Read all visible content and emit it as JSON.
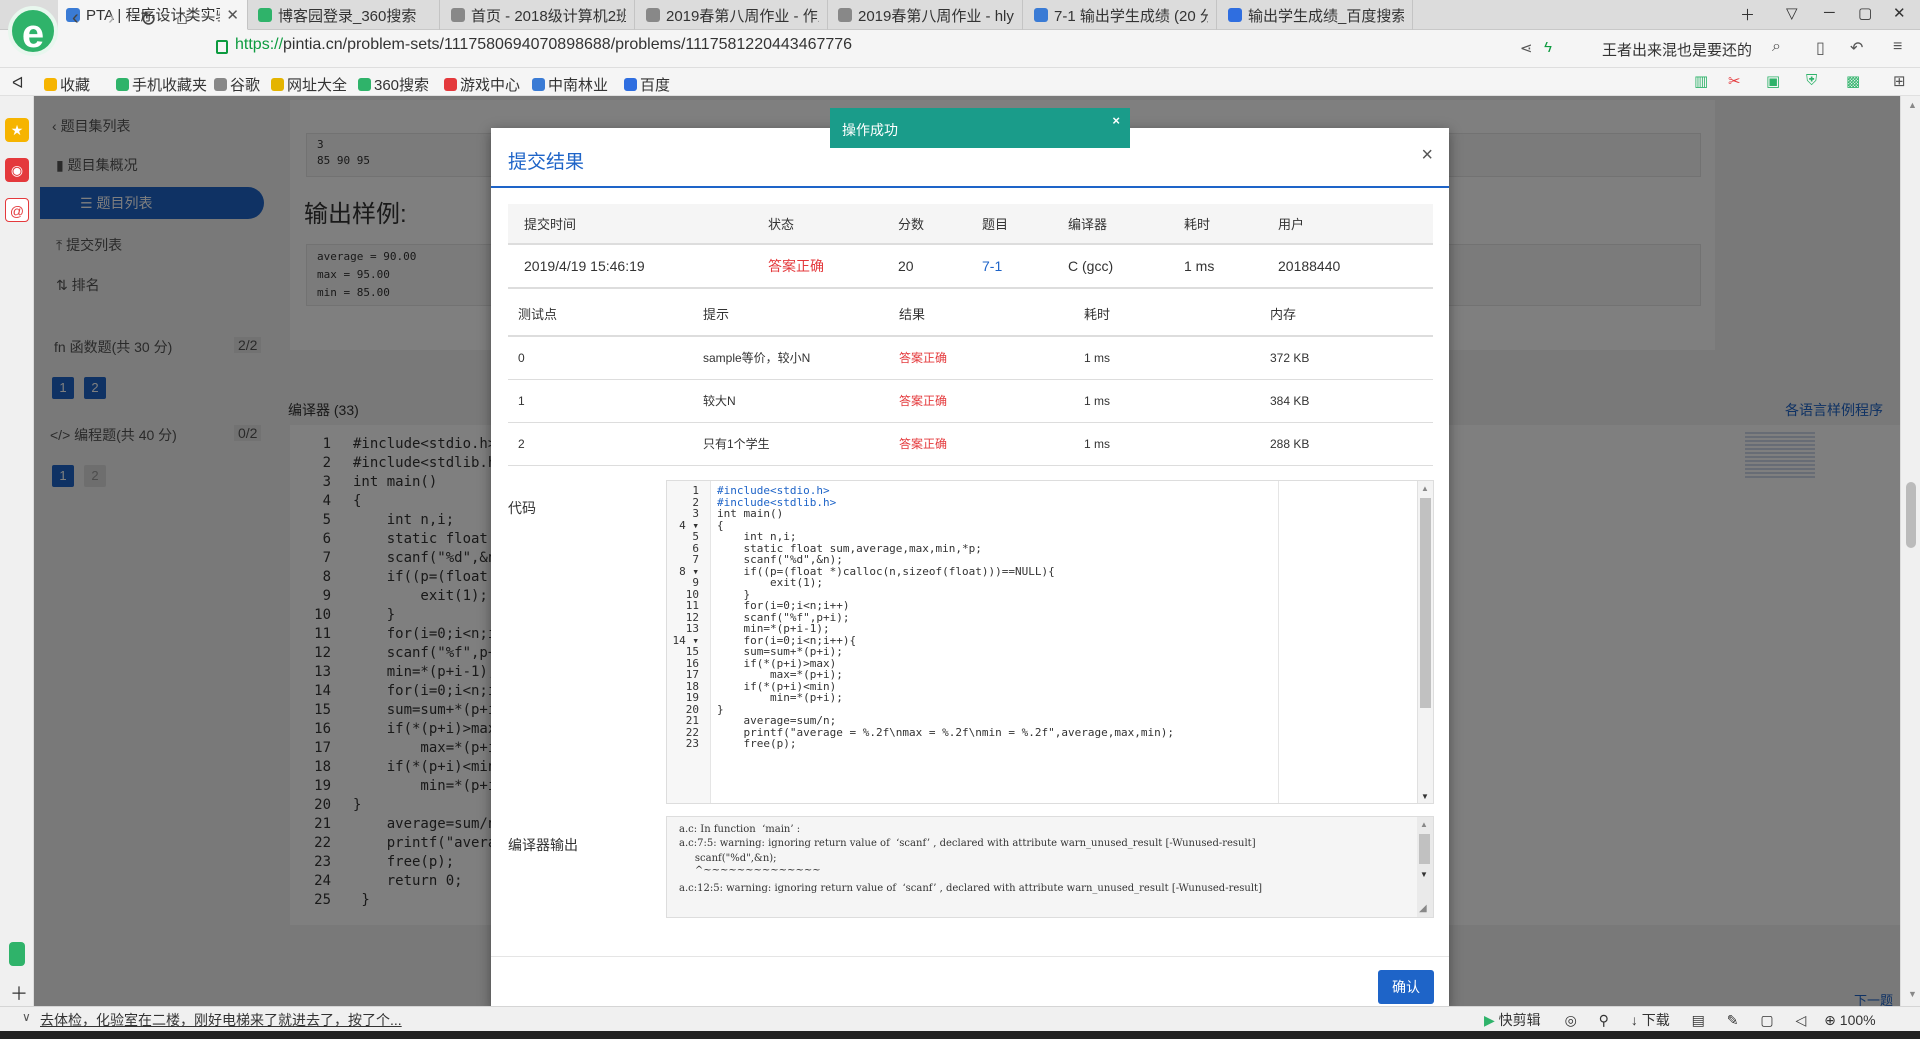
{
  "browser": {
    "tabs": [
      {
        "title": "PTA | 程序设计类实验辅助",
        "color": "#3a7bd5",
        "active": true
      },
      {
        "title": "博客园登录_360搜索",
        "color": "#2fb36a",
        "active": false
      },
      {
        "title": "首页 - 2018级计算机2班 -",
        "color": "#888888",
        "active": false
      },
      {
        "title": "2019春第八周作业 - 作业",
        "color": "#888888",
        "active": false
      },
      {
        "title": "2019春第八周作业 - hlyw",
        "color": "#888888",
        "active": false
      },
      {
        "title": "7-1 输出学生成绩 (20 分)",
        "color": "#3a7bd5",
        "active": false
      },
      {
        "title": "输出学生成绩_百度搜索",
        "color": "#2f6ee0",
        "active": false
      }
    ],
    "url_scheme": "https://",
    "url_rest": "pintia.cn/problem-sets/1117580694070898688/problems/1117581220443467776",
    "search_hint": "王者出来混也是要还的",
    "bookmarks": [
      "收藏",
      "手机收藏夹",
      "谷歌",
      "网址大全",
      "360搜索",
      "游戏中心",
      "中南林业",
      "百度"
    ]
  },
  "sidebar": {
    "back": "题目集列表",
    "items": [
      "题目集概况",
      "题目列表",
      "提交列表",
      "排名"
    ],
    "func_section": "函数题(共 30 分)",
    "func_count": "2/2",
    "prog_section": "编程题(共 40 分)",
    "prog_count": "0/2",
    "pages": [
      "1",
      "2"
    ]
  },
  "problem": {
    "sample_input_lines": [
      "3",
      "85 90 95"
    ],
    "output_title": "输出样例:",
    "sample_output_lines": [
      "average = 90.00",
      "max = 95.00",
      "min = 85.00"
    ],
    "editor_label": "编译器 (33)",
    "other_lang_link": "各语言样例程序",
    "next_link": "下一题"
  },
  "bg_code": [
    "#include<stdio.h>",
    "#include<stdlib.h",
    "int main()",
    "{",
    "    int n,i;",
    "    static float",
    "    scanf(\"%d\",&n",
    "    if((p=(float",
    "        exit(1);",
    "    }",
    "    for(i=0;i<n;i",
    "    scanf(\"%f\",p+",
    "    min=*(p+i-1);",
    "    for(i=0;i<n;i",
    "    sum=sum+*(p+i",
    "    if(*(p+i)>max",
    "        max=*(p+i",
    "    if(*(p+i)<min",
    "        min=*(p+i",
    "}",
    "    average=sum/n",
    "    printf(\"avera",
    "    free(p);",
    "    return 0;",
    " }"
  ],
  "toast": {
    "message": "操作成功",
    "close": "×"
  },
  "modal": {
    "title": "提交结果",
    "close": "×",
    "summary_headers": [
      "提交时间",
      "状态",
      "分数",
      "题目",
      "编译器",
      "耗时",
      "用户"
    ],
    "summary_row": [
      "2019/4/19 15:46:19",
      "答案正确",
      "20",
      "7-1",
      "C (gcc)",
      "1 ms",
      "20188440"
    ],
    "test_headers": [
      "测试点",
      "提示",
      "结果",
      "耗时",
      "内存"
    ],
    "test_rows": [
      [
        "0",
        "sample等价，较小N",
        "答案正确",
        "1 ms",
        "372 KB"
      ],
      [
        "1",
        "较大N",
        "答案正确",
        "1 ms",
        "384 KB"
      ],
      [
        "2",
        "只有1个学生",
        "答案正确",
        "1 ms",
        "288 KB"
      ]
    ],
    "code_label": "代码",
    "code_lines": [
      "#include<stdio.h>",
      "#include<stdlib.h>",
      "int main()",
      "{",
      "    int n,i;",
      "    static float sum,average,max,min,*p;",
      "    scanf(\"%d\",&n);",
      "    if((p=(float *)calloc(n,sizeof(float)))==NULL){",
      "        exit(1);",
      "    }",
      "    for(i=0;i<n;i++)",
      "    scanf(\"%f\",p+i);",
      "    min=*(p+i-1);",
      "    for(i=0;i<n;i++){",
      "    sum=sum+*(p+i);",
      "    if(*(p+i)>max)",
      "        max=*(p+i);",
      "    if(*(p+i)<min)",
      "        min=*(p+i);",
      "}",
      "    average=sum/n;",
      "    printf(\"average = %.2f\\nmax = %.2f\\nmin = %.2f\",average,max,min);",
      "    free(p);"
    ],
    "output_label": "编译器输出",
    "compiler_output": [
      "a.c: In function  ‘main’ :",
      "a.c:7:5: warning: ignoring return value of  ‘scanf’ , declared with attribute warn_unused_result [-Wunused-result]",
      "     scanf(\"%d\",&n);",
      "     ^~~~~~~~~~~~~~~",
      "a.c:12:5: warning: ignoring return value of  ‘scanf’ , declared with attribute warn_unused_result [-Wunused-result]"
    ],
    "confirm": "确认"
  },
  "statusbar": {
    "news": "去体检，化验室在二楼，刚好电梯来了就进去了，按了个...",
    "clip": "快剪辑",
    "download": "下载",
    "zoom": "100%"
  }
}
